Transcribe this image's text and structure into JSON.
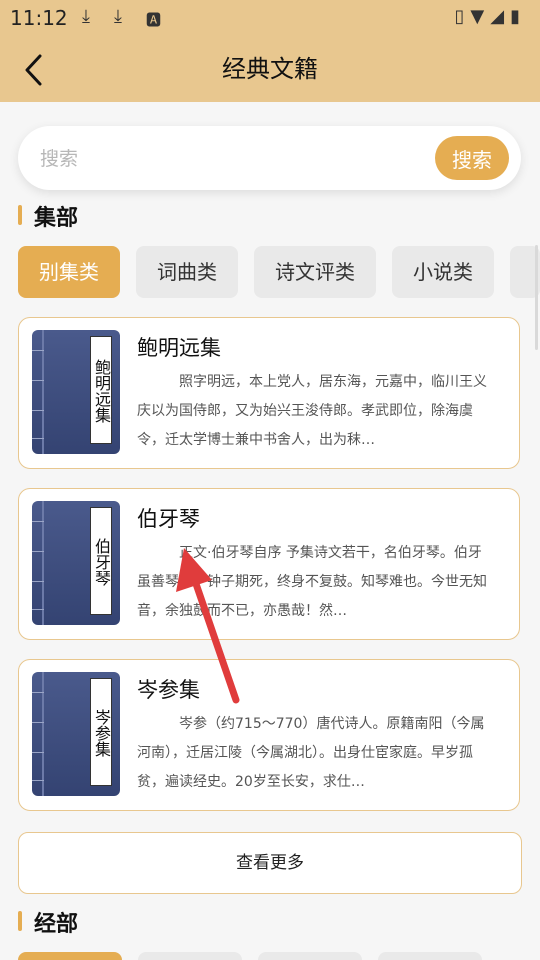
{
  "status_bar": {
    "time": "11:12",
    "icons": [
      "download-icon",
      "download-icon",
      "font-icon",
      "vibrate-icon",
      "wifi-icon",
      "signal-icon",
      "battery-icon"
    ]
  },
  "header": {
    "title": "经典文籍",
    "back_icon": "chevron-left-icon"
  },
  "search": {
    "placeholder": "搜索",
    "button_label": "搜索"
  },
  "section1": {
    "title": "集部",
    "tabs": [
      {
        "label": "别集类",
        "active": true
      },
      {
        "label": "词曲类",
        "active": false
      },
      {
        "label": "诗文评类",
        "active": false
      },
      {
        "label": "小说类",
        "active": false
      }
    ],
    "books": [
      {
        "title": "鲍明远集",
        "cover_text": "鲍明远集",
        "desc": "照字明远，本上党人，居东海，元嘉中，临川王义庆以为国侍郎，又为始兴王浚侍郎。孝武即位，除海虞令，迁太学博士兼中书舍人，出为秣…"
      },
      {
        "title": "伯牙琴",
        "cover_text": "伯牙琴",
        "desc": "正文·伯牙琴自序 予集诗文若干，名伯牙琴。伯牙虽善琴者，钟子期死，终身不复鼓。知琴难也。今世无知音，余独鼓而不已，亦愚哉！然…"
      },
      {
        "title": "岑参集",
        "cover_text": "岑参集",
        "desc": "岑参（约715～770）唐代诗人。原籍南阳（今属河南），迁居江陵（今属湖北）。出身仕宦家庭。早岁孤贫，遍读经史。20岁至长安，求仕…"
      }
    ],
    "more_label": "查看更多"
  },
  "section2": {
    "title": "经部"
  },
  "colors": {
    "accent": "#e5ad52",
    "header_bg": "#e8c78f",
    "cover_blue": "#3d4c7e",
    "arrow_red": "#e03c3c"
  }
}
